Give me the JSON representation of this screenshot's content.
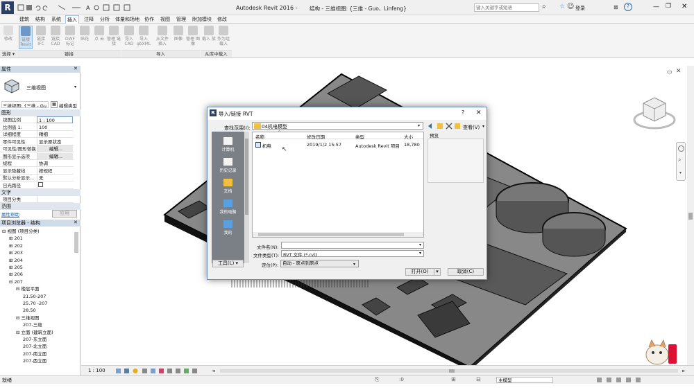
{
  "app": {
    "title": "Autodesk Revit 2016 -",
    "doc_title": "结构 - 三维视图: {三维 - Guo、Linfeng}",
    "search_placeholder": "键入关键字或短语",
    "user": "登录",
    "app_letter": "R"
  },
  "ribbon_tabs": [
    "建筑",
    "结构",
    "系统",
    "插入",
    "注释",
    "分析",
    "体量和场地",
    "协作",
    "视图",
    "管理",
    "附加模块",
    "修改"
  ],
  "ribbon_buttons": [
    {
      "label": "修改"
    },
    {
      "label": "链接 Revit"
    },
    {
      "label": "链接 IFC"
    },
    {
      "label": "链接 CAD"
    },
    {
      "label": "DWF 标记"
    },
    {
      "label": "贴花"
    },
    {
      "label": "点 云"
    },
    {
      "label": "管理 链接"
    },
    {
      "label": "导入 CAD"
    },
    {
      "label": "导入 gbXML"
    },
    {
      "label": "从文件 插入"
    },
    {
      "label": "图像"
    },
    {
      "label": "管理 图像"
    },
    {
      "label": "载入 族"
    },
    {
      "label": "作为组 载入"
    }
  ],
  "ribbon_groups": [
    "选择 ▾",
    "链接",
    "导入",
    "从库中载入"
  ],
  "properties": {
    "header": "属性",
    "type_name": "三维视图",
    "selector": "三维视图: {三维 - Gu",
    "edit_type": "编辑类型",
    "graphics_section": "图形",
    "rows": [
      {
        "k": "视图比例",
        "v": "1 : 100"
      },
      {
        "k": "比例值 1:",
        "v": "100"
      },
      {
        "k": "详细程度",
        "v": "精细"
      },
      {
        "k": "零件可见性",
        "v": "显示原状态"
      },
      {
        "k": "可见性/图形替换",
        "v": "编辑..."
      },
      {
        "k": "图形显示选项",
        "v": "编辑..."
      },
      {
        "k": "规程",
        "v": "协调"
      },
      {
        "k": "显示隐藏线",
        "v": "按规程"
      },
      {
        "k": "默认分析显示...",
        "v": "无"
      },
      {
        "k": "日光路径",
        "v": ""
      }
    ],
    "text_section": "文字",
    "text_rows": [
      {
        "k": "项目分类",
        "v": ""
      }
    ],
    "range_section": "范围",
    "help_link": "属性帮助",
    "apply": "应用"
  },
  "browser": {
    "header": "项目浏览器 - 结构",
    "items": [
      {
        "label": "视图 (项目分类)",
        "lvl": 0
      },
      {
        "label": "201",
        "lvl": 1
      },
      {
        "label": "202",
        "lvl": 1
      },
      {
        "label": "203",
        "lvl": 1
      },
      {
        "label": "204",
        "lvl": 1
      },
      {
        "label": "205",
        "lvl": 1
      },
      {
        "label": "206",
        "lvl": 1
      },
      {
        "label": "207",
        "lvl": 1
      },
      {
        "label": "楼层平面",
        "lvl": 2
      },
      {
        "label": "21.50-207",
        "lvl": 3
      },
      {
        "label": "25.70 -207",
        "lvl": 3
      },
      {
        "label": "28.50",
        "lvl": 3
      },
      {
        "label": "三维视图",
        "lvl": 2
      },
      {
        "label": "207-三维",
        "lvl": 3
      },
      {
        "label": "立面 (建筑立面)",
        "lvl": 2
      },
      {
        "label": "207-东立面",
        "lvl": 3
      },
      {
        "label": "207-北立面",
        "lvl": 3
      },
      {
        "label": "207-南立面",
        "lvl": 3
      },
      {
        "label": "207-西立面",
        "lvl": 3
      }
    ]
  },
  "dialog": {
    "title": "导入/链接 RVT",
    "help": "?",
    "lookin_label": "查找范围(I):",
    "lookin_value": "04机电模型",
    "view_label": "查看(V)",
    "preview_label": "预览",
    "places": [
      "计算机",
      "历史记录",
      "文档",
      "我的电脑",
      "我的"
    ],
    "columns": [
      "名称",
      "修改日期",
      "类型",
      "大小"
    ],
    "files": [
      {
        "name": "机电",
        "date": "2019/1/2 15:57",
        "type": "Autodesk Revit 项目",
        "size": "18,780"
      }
    ],
    "filename_label": "文件名(N):",
    "filename_value": "",
    "filetype_label": "文件类型(T):",
    "filetype_value": "RVT 文件 (*.rvt)",
    "position_label": "定位(P):",
    "position_value": "自动 - 原点到原点",
    "tools": "工具(L)",
    "open": "打开(O)",
    "cancel": "取消(C)"
  },
  "viewbar": {
    "scale": "1 : 100"
  },
  "status": {
    "text": "就绪",
    "zero": ":0",
    "model": "主模型"
  },
  "watermark": {
    "brand": "Bai du 经验",
    "url": "jingyan.baidu.com"
  }
}
